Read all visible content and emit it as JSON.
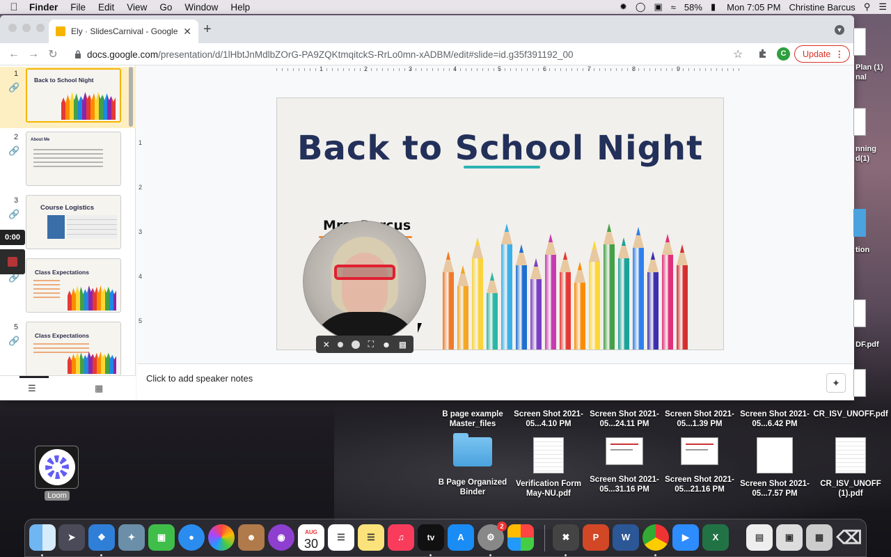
{
  "menubar": {
    "app_name": "Finder",
    "items": [
      "File",
      "Edit",
      "View",
      "Go",
      "Window",
      "Help"
    ],
    "battery": "58%",
    "clock": "Mon 7:05 PM",
    "user": "Christine Barcus"
  },
  "browser": {
    "tab_title": "Ely · SlidesCarnival - Google Sl",
    "url_domain": "docs.google.com",
    "url_path": "/presentation/d/1lHbtJnMdlbZOrG-PA9ZQKtmqitckS-RrLo0mn-xADBM/edit#slide=id.g35f391192_00",
    "profile_initial": "C",
    "update_label": "Update"
  },
  "filmstrip": {
    "slides": [
      {
        "num": "1",
        "title": "Back to School Night"
      },
      {
        "num": "2",
        "title": "About Me"
      },
      {
        "num": "3",
        "title": "Course Logistics"
      },
      {
        "num": "4",
        "title": "Class Expectations"
      },
      {
        "num": "5",
        "title": "Class Expectations"
      }
    ]
  },
  "ruler": {
    "h_ticks": [
      "1",
      "2",
      "3",
      "4",
      "5",
      "6",
      "7",
      "8",
      "9"
    ],
    "v_ticks": [
      "1",
      "2",
      "3",
      "4",
      "5"
    ]
  },
  "slide": {
    "title": "Back to School Night",
    "teacher": "Mrs. Barcus"
  },
  "notes": {
    "placeholder": "Click to add speaker notes"
  },
  "loom": {
    "timer": "0:00",
    "app_label": "Loom"
  },
  "desktop": {
    "row1": [
      "B page example Master_files",
      "Screen Shot 2021-05...4.10 PM",
      "Screen Shot 2021-05...24.11 PM",
      "Screen Shot 2021-05...1.39 PM",
      "Screen Shot 2021-05...6.42 PM",
      "CR_ISV_UNOFF.pdf"
    ],
    "row2": [
      "B Page  Organized Binder",
      "Verification Form May-NU.pdf",
      "Screen Shot 2021-05...31.16 PM",
      "Screen Shot 2021-05...21.16 PM",
      "Screen Shot 2021-05...7.57 PM",
      "CR_ISV_UNOFF (1).pdf"
    ],
    "partial_labels": [
      "Plan (1)",
      "nal",
      "nning",
      "d(1)",
      "tion",
      "DF.pdf"
    ]
  },
  "dock": {
    "calendar_month": "AUG",
    "calendar_day": "30",
    "badge_count": "2",
    "tv_label": "tv"
  },
  "colors": {
    "slide_title": "#23305a",
    "accent_teal": "#2bb3b1",
    "accent_orange": "#f28b30",
    "update_red": "#d93025"
  }
}
